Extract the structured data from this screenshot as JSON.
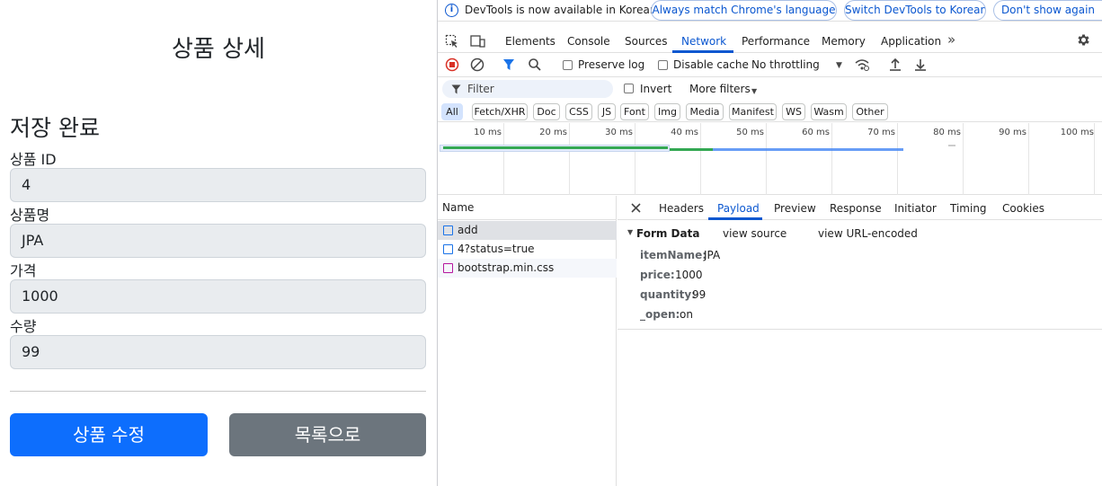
{
  "page": {
    "title": "상품 상세",
    "saved_heading": "저장 완료",
    "fields": [
      {
        "label": "상품 ID",
        "value": "4"
      },
      {
        "label": "상품명",
        "value": "JPA"
      },
      {
        "label": "가격",
        "value": "1000"
      },
      {
        "label": "수량",
        "value": "99"
      }
    ],
    "edit_button": "상품 수정",
    "list_button": "목록으로"
  },
  "devtools": {
    "infobar": {
      "text": "DevTools is now available in Korean!",
      "btn_match": "Always match Chrome's language",
      "btn_switch": "Switch DevTools to Korean",
      "btn_dont": "Don't show again"
    },
    "tabs": [
      "Elements",
      "Console",
      "Sources",
      "Network",
      "Performance",
      "Memory",
      "Application"
    ],
    "active_tab": "Network",
    "more_tabs": "»",
    "toolbar": {
      "preserve_log": "Preserve log",
      "disable_cache": "Disable cache",
      "throttling": "No throttling"
    },
    "filter": {
      "placeholder": "Filter",
      "invert": "Invert",
      "more_filters": "More filters"
    },
    "chips": [
      "All",
      "Fetch/XHR",
      "Doc",
      "CSS",
      "JS",
      "Font",
      "Img",
      "Media",
      "Manifest",
      "WS",
      "Wasm",
      "Other"
    ],
    "active_chip": "All",
    "timeline_ticks": [
      "10 ms",
      "20 ms",
      "30 ms",
      "40 ms",
      "50 ms",
      "60 ms",
      "70 ms",
      "80 ms",
      "90 ms",
      "100 ms"
    ],
    "name_header": "Name",
    "requests": [
      {
        "name": "add",
        "type": "doc",
        "selected": true
      },
      {
        "name": "4?status=true",
        "type": "doc",
        "selected": false
      },
      {
        "name": "bootstrap.min.css",
        "type": "css",
        "selected": false
      }
    ],
    "detail_tabs": [
      "Headers",
      "Payload",
      "Preview",
      "Response",
      "Initiator",
      "Timing",
      "Cookies"
    ],
    "active_detail_tab": "Payload",
    "form_data": {
      "title": "Form Data",
      "view_source": "view source",
      "view_url_encoded": "view URL-encoded",
      "entries": [
        {
          "key": "itemName:",
          "value": "JPA"
        },
        {
          "key": "price:",
          "value": "1000"
        },
        {
          "key": "quantity:",
          "value": "99"
        },
        {
          "key": "_open:",
          "value": "on"
        }
      ]
    },
    "colors": {
      "accent": "#0b57d0",
      "primary_btn": "#0d6efd",
      "secondary_btn": "#6c757d"
    }
  }
}
